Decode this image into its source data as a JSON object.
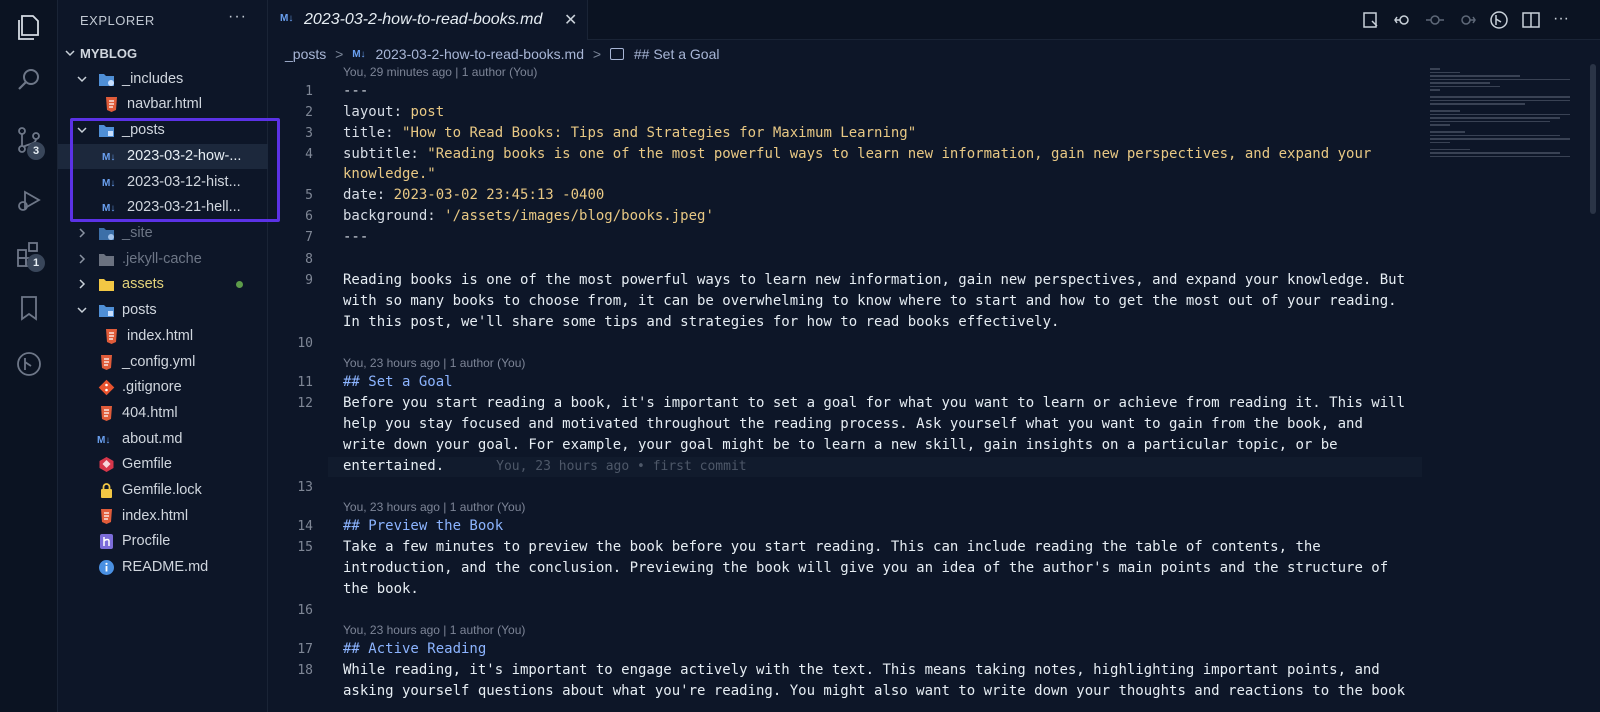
{
  "sidebar": {
    "header": "EXPLORER",
    "more": "···",
    "root": "MYBLOG",
    "badges": {
      "source_control": "3",
      "extensions": "1"
    },
    "items": [
      {
        "label": "_includes",
        "kind": "folder"
      },
      {
        "label": "navbar.html",
        "kind": "html"
      },
      {
        "label": "_posts",
        "kind": "folder"
      },
      {
        "label": "2023-03-2-how-...",
        "kind": "md"
      },
      {
        "label": "2023-03-12-hist...",
        "kind": "md"
      },
      {
        "label": "2023-03-21-hell...",
        "kind": "md"
      },
      {
        "label": "_site",
        "kind": "folder"
      },
      {
        "label": ".jekyll-cache",
        "kind": "folder"
      },
      {
        "label": "assets",
        "kind": "folder"
      },
      {
        "label": "posts",
        "kind": "folder"
      },
      {
        "label": "index.html",
        "kind": "html"
      },
      {
        "label": "_config.yml",
        "kind": "yml"
      },
      {
        "label": ".gitignore",
        "kind": "git"
      },
      {
        "label": "404.html",
        "kind": "html"
      },
      {
        "label": "about.md",
        "kind": "md"
      },
      {
        "label": "Gemfile",
        "kind": "gem"
      },
      {
        "label": "Gemfile.lock",
        "kind": "lock"
      },
      {
        "label": "index.html",
        "kind": "html"
      },
      {
        "label": "Procfile",
        "kind": "heroku"
      },
      {
        "label": "README.md",
        "kind": "info"
      }
    ]
  },
  "tab": {
    "label": "2023-03-2-how-to-read-books.md",
    "md_badge": "M↓",
    "close": "✕"
  },
  "breadcrumb": {
    "folder": "_posts",
    "file": "2023-03-2-how-to-read-books.md",
    "symbol": "## Set a Goal",
    "sep": ">"
  },
  "editor": {
    "blame_top": "You, 29 minutes ago | 1 author (You)",
    "blame_23h": "You, 23 hours ago | 1 author (You)",
    "inline_blame": "You, 23 hours ago • first commit",
    "line_numbers": [
      "1",
      "2",
      "3",
      "4",
      "5",
      "6",
      "7",
      "8",
      "9",
      "10",
      "11",
      "12",
      "13",
      "14",
      "15",
      "16",
      "17",
      "18"
    ],
    "fm_sep": "---",
    "layout_key": "layout:",
    "layout_val": "post",
    "title_key": "title:",
    "title_val": "\"How to Read Books: Tips and Strategies for Maximum Learning\"",
    "subtitle_key": "subtitle:",
    "subtitle_val_1": "\"Reading books is one of the most powerful ways to learn new information, gain new perspectives, and expand your",
    "subtitle_val_2": "knowledge.\"",
    "date_key": "date:",
    "date_val": "2023-03-02 23:45:13 -0400",
    "bg_key": "background:",
    "bg_val": "'/assets/images/blog/books.jpeg'",
    "intro": [
      "Reading books is one of the most powerful ways to learn new information, gain new perspectives, and expand your knowledge. But",
      "with so many books to choose from, it can be overwhelming to know where to start and how to get the most out of your reading.",
      "In this post, we'll share some tips and strategies for how to read books effectively."
    ],
    "h_goal": "## Set a Goal",
    "goal": [
      "Before you start reading a book, it's important to set a goal for what you want to learn or achieve from reading it. This will",
      "help you stay focused and motivated throughout the reading process. Ask yourself what you want to gain from the book, and",
      "write down your goal. For example, your goal might be to learn a new skill, gain insights on a particular topic, or be",
      "entertained."
    ],
    "h_preview": "## Preview the Book",
    "preview": [
      "Take a few minutes to preview the book before you start reading. This can include reading the table of contents, the",
      "introduction, and the conclusion. Previewing the book will give you an idea of the author's main points and the structure of",
      "the book."
    ],
    "h_active": "## Active Reading",
    "active": [
      "While reading, it's important to engage actively with the text. This means taking notes, highlighting important points, and",
      "asking yourself questions about what you're reading. You might also want to write down your thoughts and reactions to the book"
    ]
  },
  "colors": {
    "highlight_box": "#5b32e6",
    "heading": "#8cb4ff",
    "string": "#e8c884",
    "git_modified": "#5d9c4a"
  }
}
